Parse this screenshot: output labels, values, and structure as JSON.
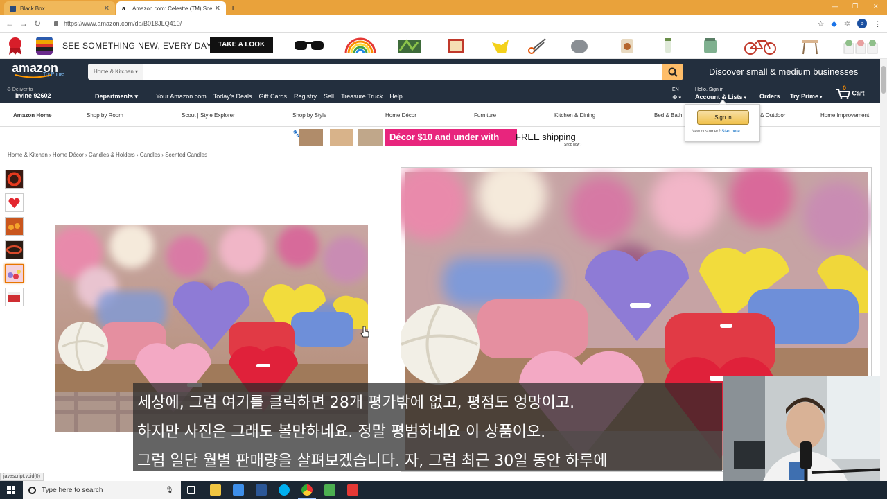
{
  "browser": {
    "tabs": [
      {
        "label": "Black Box",
        "active": false
      },
      {
        "label": "Amazon.com: Celestte (TM) Scen",
        "active": true
      }
    ],
    "url": "https://www.amazon.com/dp/B018JLQ410/",
    "profile_initial": "B"
  },
  "promo": {
    "tagline": "SEE SOMETHING NEW, EVERY DAY.",
    "button": "TAKE A LOOK"
  },
  "header": {
    "logo": "amazon",
    "logo_sub": "Try Prime",
    "search_category": "Home & Kitchen",
    "discover": "Discover small & medium businesses",
    "deliver_to": "Deliver to",
    "deliver_loc": "Irvine 92602",
    "departments": "Departments",
    "nav_links": [
      "Your Amazon.com",
      "Today's Deals",
      "Gift Cards",
      "Registry",
      "Sell",
      "Treasure Truck",
      "Help"
    ],
    "lang": "EN",
    "hello": "Hello. Sign in",
    "account": "Account & Lists",
    "orders": "Orders",
    "try_prime": "Try Prime",
    "cart_count": "0",
    "cart": "Cart"
  },
  "subnav": [
    "Amazon Home",
    "Shop by Room",
    "Scout | Style Explorer",
    "Shop by Style",
    "Home Décor",
    "Furniture",
    "Kitchen & Dining",
    "Bed & Bath",
    "& Outdoor",
    "Home Improvement"
  ],
  "signin_popup": {
    "button": "Sign in",
    "new_customer": "New customer?",
    "start_here": "Start here."
  },
  "banner": {
    "decor_text": "Décor $10 and under with",
    "free_text": "FREE shipping",
    "shop_now": "Shop now ›"
  },
  "breadcrumb": "Home & Kitchen › Home Décor › Candles & Holders › Candles › Scented Candles",
  "subtitles": [
    "세상에, 그럼 여기를 클릭하면 28개 평가밖에 없고, 평점도 엉망이고.",
    "하지만 사진은 그래도 볼만하네요. 정말 평범하네요 이 상품이오.",
    "그럼 일단 월별 판매량을 살펴보겠습니다. 자, 그럼 최근 30일 동안 하루에"
  ],
  "status_bar": "javascript:void(0)",
  "taskbar": {
    "search_placeholder": "Type here to search"
  }
}
